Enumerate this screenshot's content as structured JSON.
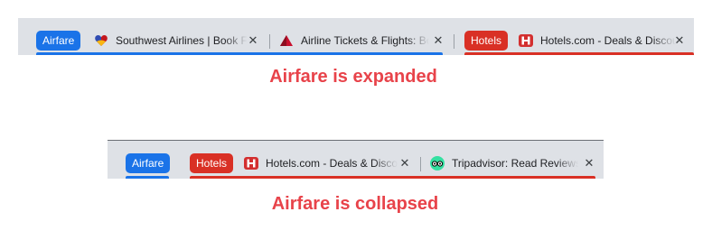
{
  "expanded": {
    "groups": {
      "airfare": {
        "label": "Airfare",
        "color": "#1a73e8"
      },
      "hotels": {
        "label": "Hotels",
        "color": "#d93025"
      }
    },
    "tabs": [
      {
        "title": "Southwest Airlines | Book Flights",
        "favicon": "southwest-heart-icon",
        "close": "✕"
      },
      {
        "title": "Airline Tickets & Flights: Book",
        "favicon": "delta-triangle-icon",
        "close": "✕"
      },
      {
        "title": "Hotels.com - Deals & Discounts",
        "favicon": "hotels-com-icon",
        "close": "✕"
      }
    ],
    "caption": "Airfare is expanded"
  },
  "collapsed": {
    "groups": {
      "airfare": {
        "label": "Airfare",
        "color": "#1a73e8"
      },
      "hotels": {
        "label": "Hotels",
        "color": "#d93025"
      }
    },
    "tabs": [
      {
        "title": "Hotels.com - Deals & Discounts",
        "favicon": "hotels-com-icon",
        "close": "✕"
      },
      {
        "title": "Tripadvisor: Read Reviews, Compare",
        "favicon": "tripadvisor-owl-icon",
        "close": "✕"
      }
    ],
    "caption": "Airfare is collapsed"
  }
}
